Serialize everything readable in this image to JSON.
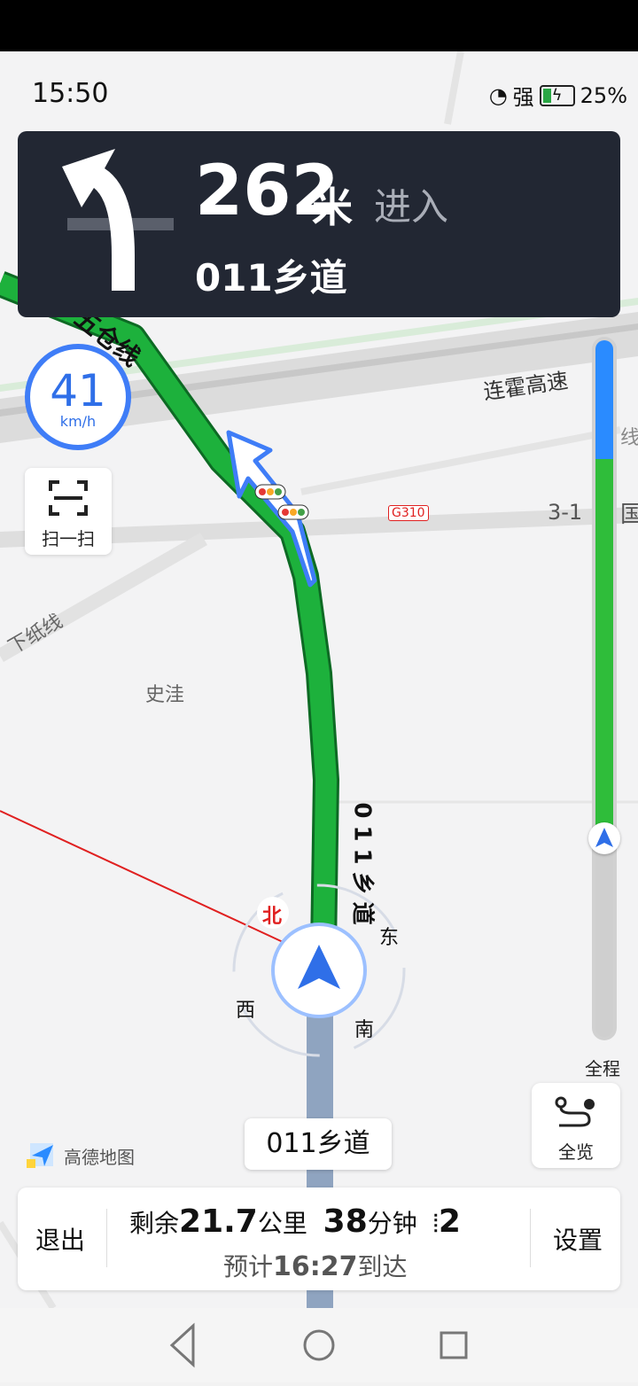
{
  "status_bar": {
    "time": "15:50",
    "signal": "强",
    "battery": "25%"
  },
  "guidance": {
    "distance": "262",
    "unit": "米",
    "action": "进入",
    "road": "011乡道"
  },
  "speed": {
    "value": "41",
    "unit": "km/h"
  },
  "scan": {
    "label": "扫一扫"
  },
  "progress": {
    "label": "全程"
  },
  "overview": {
    "label": "全览"
  },
  "map_labels": {
    "road_wucang": "五仓线",
    "expressway": "连霍高速",
    "highway_code": "G310",
    "road_number": "3-1",
    "guo": "国",
    "xian": "线",
    "xiazhi": "下纸线",
    "village": "史洼",
    "route_road": "011乡道",
    "compass": {
      "north": "北",
      "east": "东",
      "west": "西",
      "south": "南"
    }
  },
  "brand": {
    "logo": "高德地图"
  },
  "current_road": "011乡道",
  "trip": {
    "exit": "退出",
    "remaining_prefix": "剩余",
    "remaining_distance": "21.7",
    "distance_unit": "公里",
    "remaining_time": "38",
    "time_unit": "分钟",
    "traffic_lights": "2",
    "eta_prefix": "预计",
    "eta_time": "16:27",
    "eta_suffix": "到达",
    "settings": "设置"
  },
  "colors": {
    "route_green": "#1db13c",
    "accent_blue": "#3f7df7",
    "panel_dark": "#222733"
  }
}
